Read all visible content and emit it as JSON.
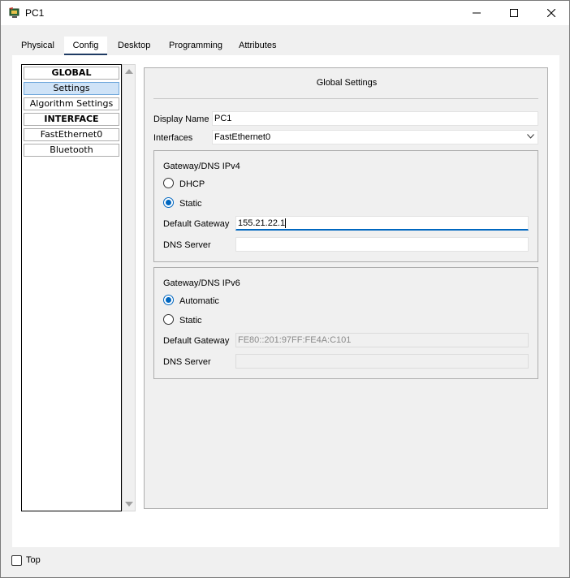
{
  "window": {
    "title": "PC1"
  },
  "tabs": [
    {
      "label": "Physical"
    },
    {
      "label": "Config"
    },
    {
      "label": "Desktop"
    },
    {
      "label": "Programming"
    },
    {
      "label": "Attributes"
    }
  ],
  "active_tab": "Config",
  "nav": {
    "global_header": "GLOBAL",
    "items": [
      "Settings",
      "Algorithm Settings"
    ],
    "interface_header": "INTERFACE",
    "interfaces": [
      "FastEthernet0",
      "Bluetooth"
    ],
    "selected": "Settings"
  },
  "settings": {
    "title": "Global Settings",
    "display_name_label": "Display Name",
    "display_name_value": "PC1",
    "interfaces_label": "Interfaces",
    "interfaces_value": "FastEthernet0",
    "ipv4": {
      "title": "Gateway/DNS IPv4",
      "dhcp_label": "DHCP",
      "static_label": "Static",
      "selected_mode": "Static",
      "gateway_label": "Default Gateway",
      "gateway_value": "155.21.22.1",
      "dns_label": "DNS Server",
      "dns_value": ""
    },
    "ipv6": {
      "title": "Gateway/DNS IPv6",
      "automatic_label": "Automatic",
      "static_label": "Static",
      "selected_mode": "Automatic",
      "gateway_label": "Default Gateway",
      "gateway_value": "FE80::201:97FF:FE4A:C101",
      "dns_label": "DNS Server",
      "dns_value": ""
    }
  },
  "footer": {
    "top_label": "Top",
    "top_checked": false
  },
  "colors": {
    "accent": "#0067c0",
    "tab_underline": "#1f3b63",
    "selection": "#cfe3f7"
  }
}
